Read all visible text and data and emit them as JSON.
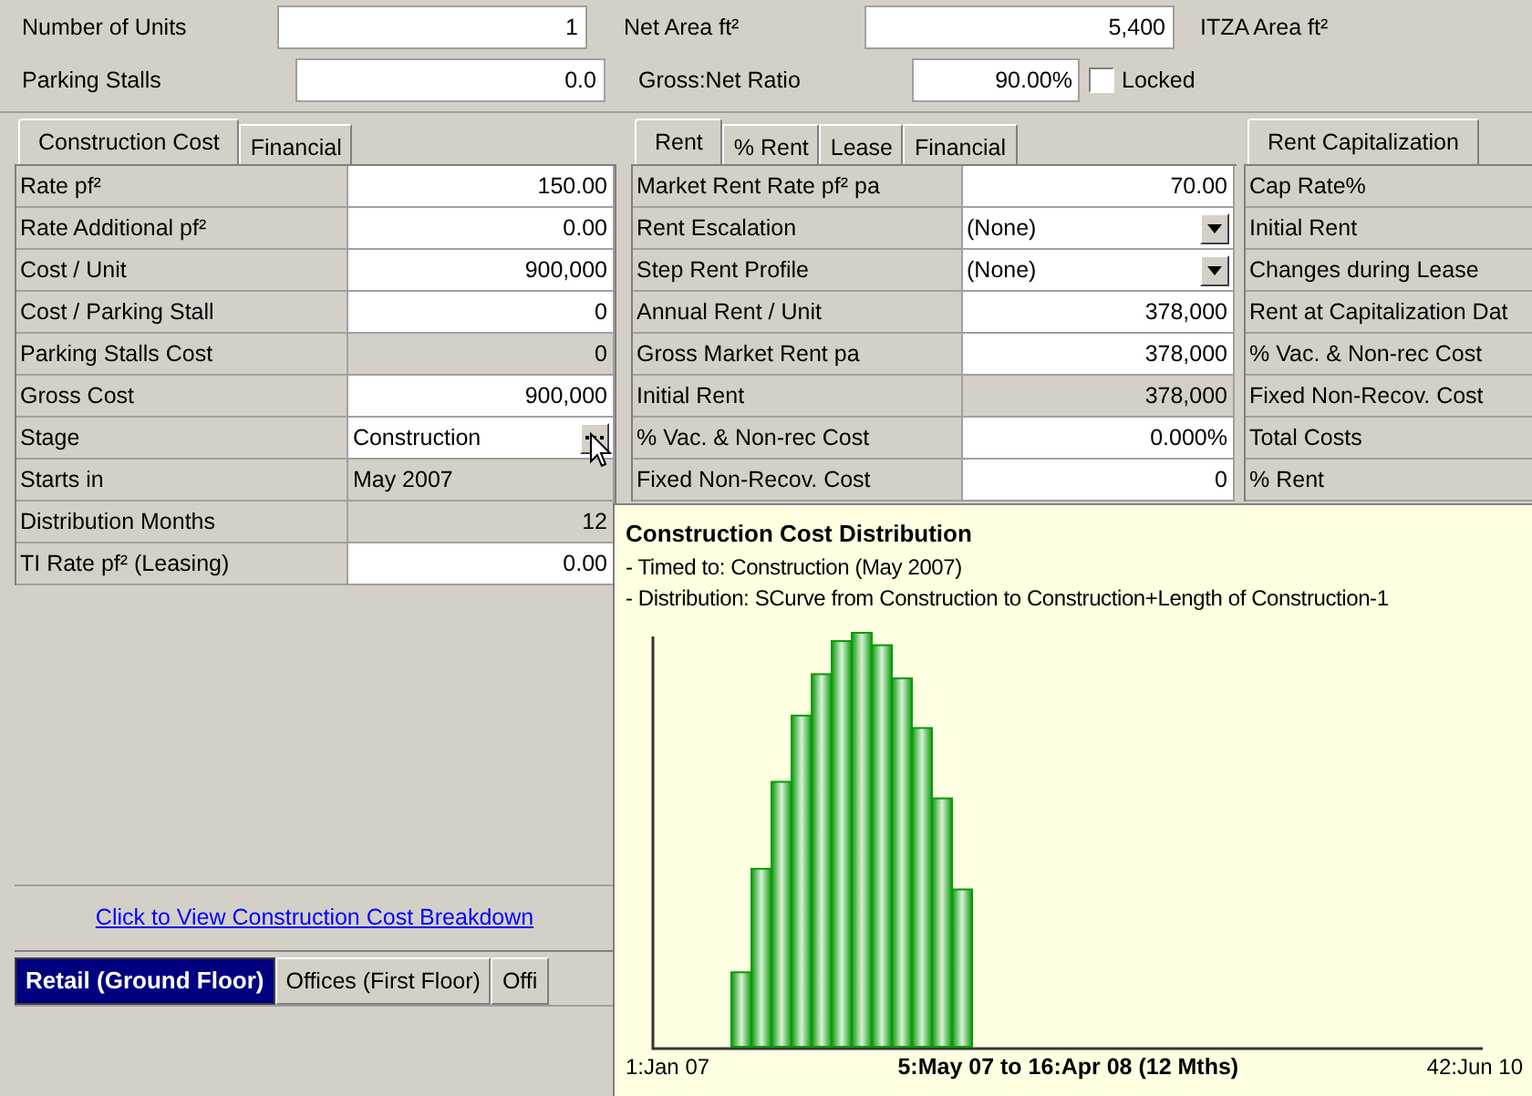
{
  "top_fields": [
    {
      "label": "Number of Units",
      "value": "1"
    },
    {
      "label": "Net Area ft²",
      "value": "5,400"
    },
    {
      "label": "ITZA Area ft²"
    },
    {
      "label": "Parking Stalls",
      "value": "0.0"
    },
    {
      "label": "Gross:Net Ratio",
      "value": "90.00%"
    }
  ],
  "locked": {
    "label": "Locked",
    "checked": false
  },
  "left_panel": {
    "tabs": [
      {
        "label": "Construction Cost",
        "selected": true
      },
      {
        "label": "Financial",
        "selected": false
      }
    ],
    "rows": [
      {
        "label": "Rate pf²",
        "value": "150.00",
        "kind": "input"
      },
      {
        "label": "Rate Additional pf²",
        "value": "0.00",
        "kind": "input"
      },
      {
        "label": "Cost / Unit",
        "value": "900,000",
        "kind": "input"
      },
      {
        "label": "Cost / Parking Stall",
        "value": "0",
        "kind": "input"
      },
      {
        "label": "Parking Stalls Cost",
        "value": "0",
        "kind": "readonly"
      },
      {
        "label": "Gross Cost",
        "value": "900,000",
        "kind": "input"
      },
      {
        "label": "Stage",
        "value": "Construction",
        "kind": "picker"
      },
      {
        "label": "Starts in",
        "value": "May 2007",
        "kind": "readonly_left"
      },
      {
        "label": "Distribution Months",
        "value": "12",
        "kind": "readonly"
      },
      {
        "label": "TI Rate pf² (Leasing)",
        "value": "0.00",
        "kind": "input"
      }
    ],
    "link": "Click to View Construction Cost Breakdown"
  },
  "middle_panel": {
    "tabs": [
      {
        "label": "Rent",
        "selected": true
      },
      {
        "label": "% Rent",
        "selected": false
      },
      {
        "label": "Lease",
        "selected": false
      },
      {
        "label": "Financial",
        "selected": false
      }
    ],
    "rows": [
      {
        "label": "Market Rent Rate pf² pa",
        "value": "70.00",
        "kind": "input"
      },
      {
        "label": "Rent Escalation",
        "value": "(None)",
        "kind": "dropdown"
      },
      {
        "label": "Step Rent Profile",
        "value": "(None)",
        "kind": "dropdown"
      },
      {
        "label": "Annual Rent / Unit",
        "value": "378,000",
        "kind": "input"
      },
      {
        "label": "Gross Market Rent pa",
        "value": "378,000",
        "kind": "input"
      },
      {
        "label": "Initial Rent",
        "value": "378,000",
        "kind": "readonly"
      },
      {
        "label": "% Vac. & Non-rec Cost",
        "value": "0.000%",
        "kind": "input"
      },
      {
        "label": "Fixed Non-Recov. Cost",
        "value": "0",
        "kind": "input"
      }
    ]
  },
  "right_panel": {
    "tabs": [
      {
        "label": "Rent Capitalization",
        "selected": true
      }
    ],
    "rows": [
      "Cap Rate%",
      "Initial Rent",
      "Changes during Lease",
      "Rent at Capitalization Dat",
      "% Vac. & Non-rec Cost",
      "Fixed Non-Recov. Cost",
      "Total Costs",
      "% Rent"
    ]
  },
  "building_tabs": [
    {
      "label": "Retail (Ground Floor)",
      "selected": true
    },
    {
      "label": "Offices (First Floor)",
      "selected": false
    },
    {
      "label": "Offi",
      "selected": false
    }
  ],
  "tooltip": {
    "title": "Construction Cost Distribution",
    "lines": [
      "- Timed to: Construction (May 2007)",
      "- Distribution: SCurve from Construction to Construction+Length of Construction-1"
    ],
    "axis_start": "1:Jan 07",
    "range": "5:May 07 to 16:Apr 08 (12 Mths)",
    "axis_end": "42:Jun 10"
  }
}
